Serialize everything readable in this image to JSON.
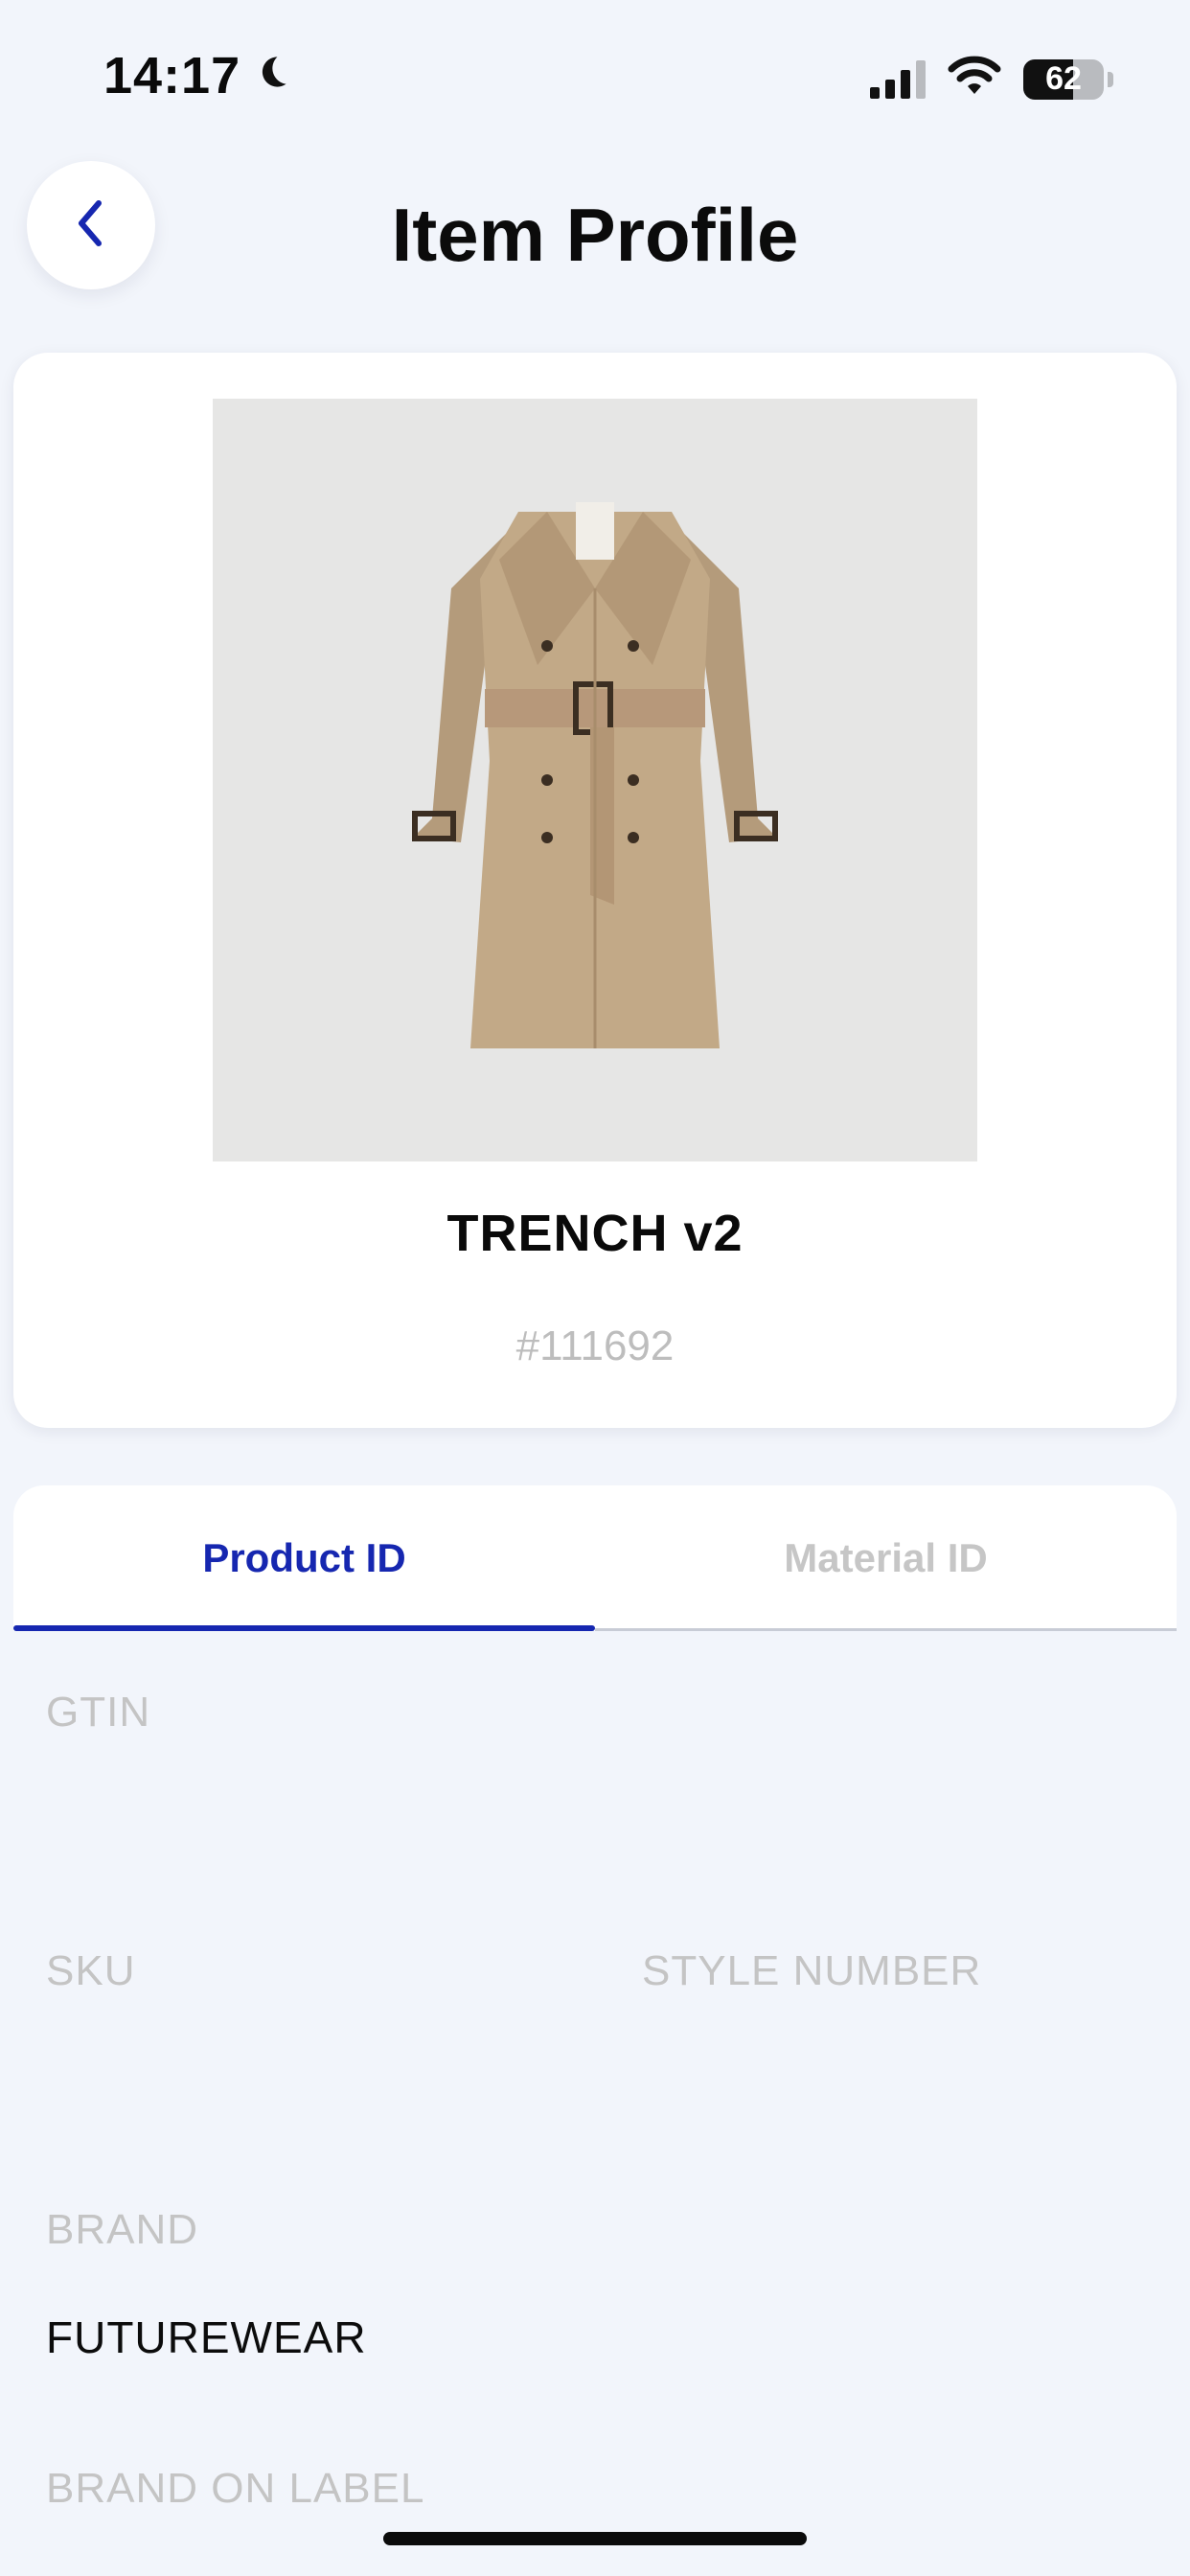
{
  "status_bar": {
    "time": "14:17",
    "battery": "62",
    "battery_level": 0.62
  },
  "header": {
    "title": "Item Profile"
  },
  "product": {
    "name": "TRENCH v2",
    "number": "#111692"
  },
  "tabs": [
    {
      "label": "Product ID",
      "active": true
    },
    {
      "label": "Material ID",
      "active": false
    }
  ],
  "fields": {
    "gtin_label": "GTIN",
    "gtin_value": "",
    "sku_label": "SKU",
    "sku_value": "",
    "style_number_label": "STYLE NUMBER",
    "style_number_value": "",
    "brand_label": "BRAND",
    "brand_value": "FUTUREWEAR",
    "brand_on_label_label": "BRAND ON LABEL"
  },
  "colors": {
    "accent": "#1627b0",
    "background": "#f2f5fb",
    "muted": "#c4c4c4"
  },
  "icons": [
    "moon-icon",
    "cellular-signal-icon",
    "wifi-icon",
    "battery-icon",
    "back-chevron-icon",
    "coat-image"
  ]
}
